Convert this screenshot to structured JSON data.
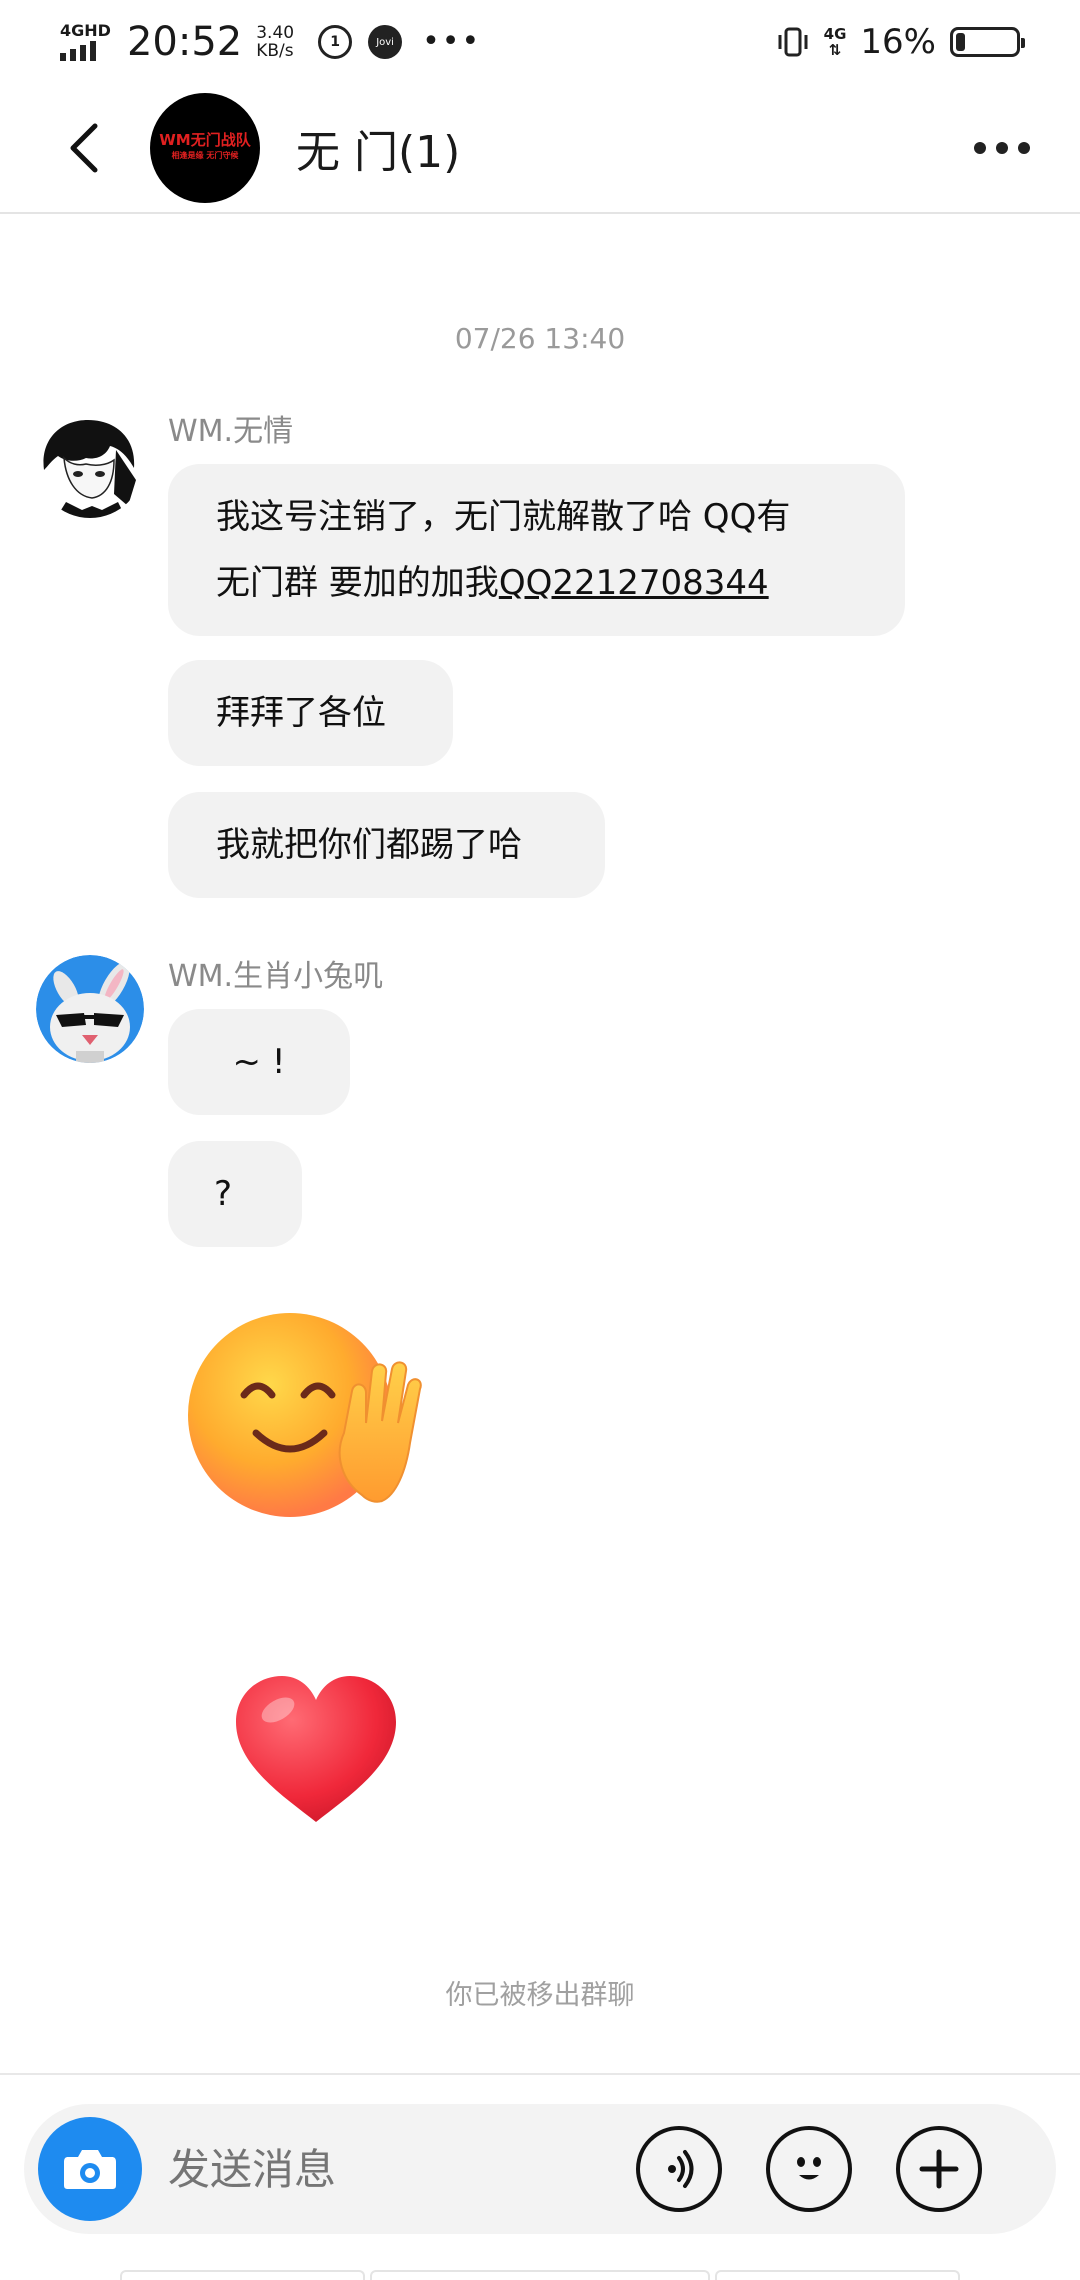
{
  "status_bar": {
    "network": "4GHD",
    "time": "20:52",
    "speed_value": "3.40",
    "speed_unit": "KB/s",
    "app_icon_label": "1",
    "jovi_label": "Jovi",
    "lte_label": "4G",
    "battery": "16%",
    "battery_level": 0.16
  },
  "header": {
    "title": "无 门(1)",
    "avatar_text": "WM无门战队",
    "avatar_subtext": "相逢是缘 无门守候"
  },
  "chat": {
    "timestamp": "07/26 13:40",
    "groups": [
      {
        "sender": "WM.无情",
        "messages": [
          {
            "line1": "我这号注销了，无门就解散了哈 QQ有",
            "line2_prefix": "无门群 要加的加我",
            "line2_link": "QQ2212708344"
          },
          {
            "text": "拜拜了各位"
          },
          {
            "text": "我就把你们都踢了哈"
          }
        ]
      },
      {
        "sender": "WM.生肖小兔叽",
        "messages": [
          {
            "text": "~ !"
          },
          {
            "text": "?"
          }
        ],
        "stickers": [
          "smile-wave-emoji",
          "red-heart-emoji"
        ]
      }
    ],
    "system_note": "你已被移出群聊"
  },
  "input": {
    "placeholder": "发送消息"
  },
  "colors": {
    "accent": "#1e8bf0",
    "bubble": "#f2f2f2",
    "meta_text": "#9a9a9a"
  }
}
